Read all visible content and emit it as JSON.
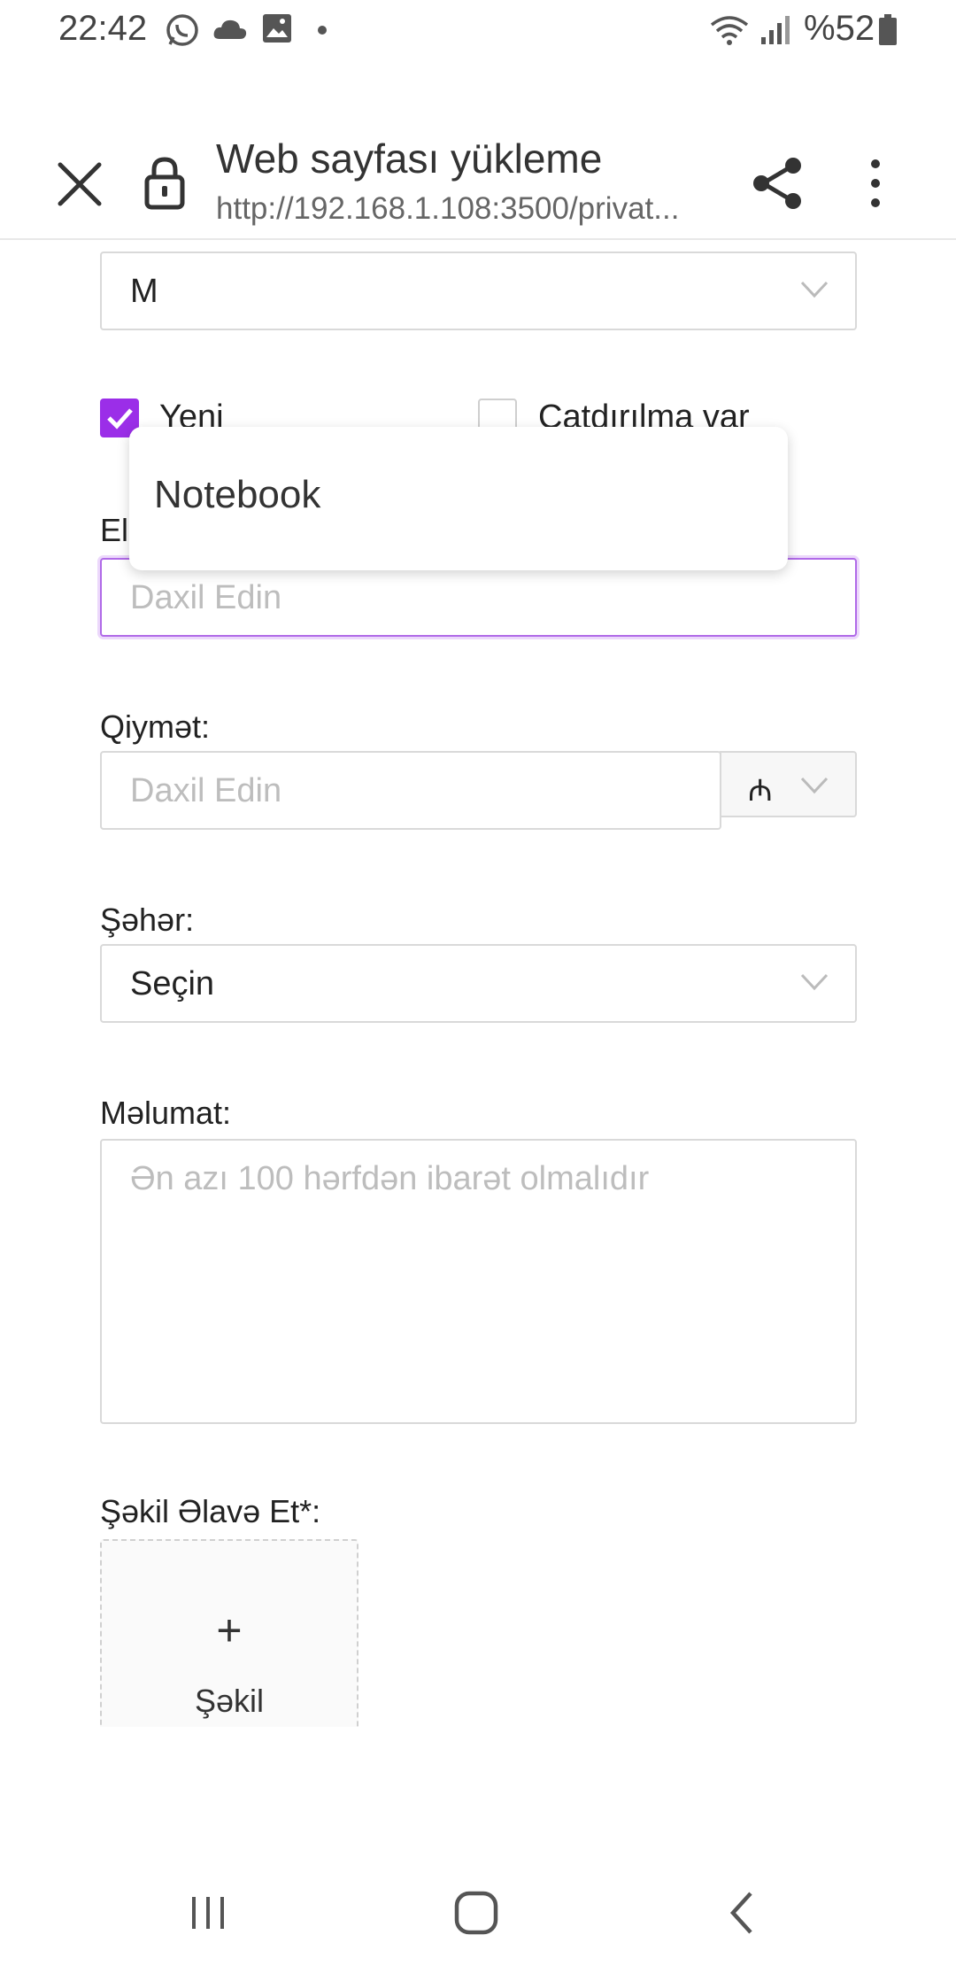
{
  "status_bar": {
    "time": "22:42",
    "battery": "%52",
    "icons": [
      "whatsapp-icon",
      "cloud-icon",
      "gallery-icon",
      "dot-icon",
      "wifi-icon",
      "signal-icon",
      "battery-icon"
    ]
  },
  "header": {
    "title": "Web sayfası yükleme",
    "url": "http://192.168.1.108:3500/privat..."
  },
  "form": {
    "size_select_value": "M",
    "checkbox_new": {
      "label": "Yeni",
      "checked": true
    },
    "checkbox_delivery": {
      "label": "Çatdırılma var",
      "checked": false
    },
    "name_label_partial": "El",
    "name_placeholder": "Daxil Edin",
    "price_label": "Qiymət:",
    "price_placeholder": "Daxil Edin",
    "currency_symbol": "₼",
    "city_label": "Şəhər:",
    "city_value": "Seçin",
    "info_label": "Məlumat:",
    "info_placeholder": "Ən azı 100 hərfdən ibarət olmalıdır",
    "photo_label": "Şəkil Əlavə Et*:",
    "photo_button_plus": "+",
    "photo_button_text": "Şəkil"
  },
  "autocomplete": {
    "suggestion": "Notebook"
  },
  "colors": {
    "accent": "#9b2ee8",
    "focus_border": "#b06ae8"
  }
}
